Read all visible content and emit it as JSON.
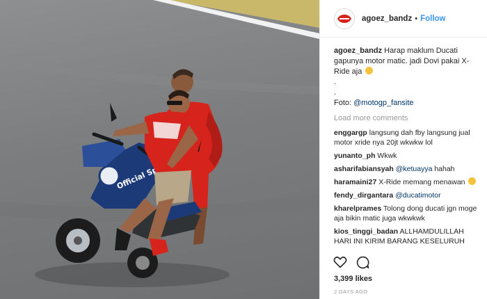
{
  "post": {
    "username": "agoez_bandz",
    "separator": "•",
    "follow_label": "Follow",
    "caption_lines": [
      "Harap maklum Ducati gapunya motor matic. jadi Dovi pakai X-Ride aja",
      ".",
      "."
    ],
    "foto_prefix": "Foto: ",
    "foto_mention": "@motogp_fansite",
    "load_more": "Load more comments",
    "comments": [
      {
        "user": "enggargp",
        "text": "langsung dah fby langsung jual motor xride nya 20jt wkwkw lol"
      },
      {
        "user": "yunanto_ph",
        "text": "Wkwk"
      },
      {
        "user": "asharifabiansyah",
        "text": "",
        "mention": "@ketuayya",
        "after": "hahah"
      },
      {
        "user": "haramaini27",
        "text": "X-Ride memang menawan"
      },
      {
        "user": "fendy_dirgantara",
        "text": "",
        "mention": "@ducatimotor",
        "after": ""
      },
      {
        "user": "kharelprames",
        "text": "Tolong dong ducati jgn moge aja bikin matic juga wkwkwk"
      },
      {
        "user": "kios_tinggi_badan",
        "text": "ALLHAMDULILLAH HARI INI KIRIM BARANG KESELURUH INDO"
      }
    ],
    "likes": "3,399 likes",
    "time_ago": "2 DAYS AGO"
  },
  "photo": {
    "scooter_text": "Official Sponsor"
  },
  "icons": {
    "avatar": "ducati-logo-icon",
    "like": "heart-icon",
    "comment": "speech-bubble-icon"
  },
  "colors": {
    "follow": "#3897f0",
    "muted": "#999999",
    "ducati_red": "#d6241d",
    "scooter_blue": "#1d3a78"
  }
}
